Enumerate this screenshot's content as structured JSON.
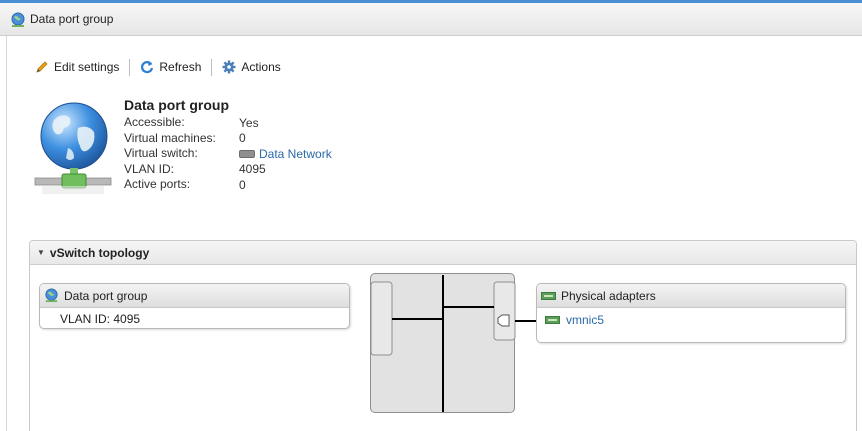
{
  "window": {
    "title": "Data port group",
    "title_icon": "portgroup-globe-icon"
  },
  "toolbar": {
    "edit_label": "Edit settings",
    "refresh_label": "Refresh",
    "actions_label": "Actions"
  },
  "summary": {
    "heading": "Data port group",
    "rows": [
      {
        "label": "Accessible:",
        "value": "Yes"
      },
      {
        "label": "Virtual machines:",
        "value": "0"
      },
      {
        "label": "Virtual switch:",
        "value": "Data Network"
      },
      {
        "label": "VLAN ID:",
        "value": "4095"
      },
      {
        "label": "Active ports:",
        "value": "0"
      }
    ]
  },
  "topology": {
    "header": "vSwitch topology",
    "portgroup_title": "Data port group",
    "portgroup_vlan": "VLAN ID: 4095",
    "adapters_title": "Physical adapters",
    "adapter_name": "vmnic5"
  },
  "colors": {
    "accent": "#4b8fd3",
    "link": "#2b6aa8",
    "nic_green": "#5a9e58"
  }
}
